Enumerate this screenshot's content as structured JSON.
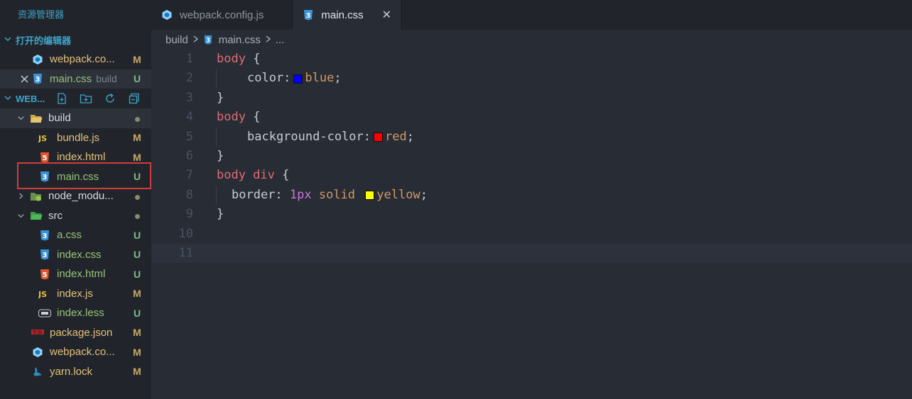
{
  "sidebar": {
    "title": "资源管理器",
    "open_editors": {
      "heading": "打开的编辑器",
      "items": [
        {
          "name": "webpack.co...",
          "desc": "",
          "status": "M"
        },
        {
          "name": "main.css",
          "desc": "build",
          "status": "U"
        }
      ]
    },
    "workspace": {
      "heading": "WEB...",
      "items": [
        {
          "name": "build",
          "status": ""
        },
        {
          "name": "bundle.js",
          "status": "M"
        },
        {
          "name": "index.html",
          "status": "M"
        },
        {
          "name": "main.css",
          "status": "U"
        },
        {
          "name": "node_modu...",
          "status": ""
        },
        {
          "name": "src",
          "status": ""
        },
        {
          "name": "a.css",
          "status": "U"
        },
        {
          "name": "index.css",
          "status": "U"
        },
        {
          "name": "index.html",
          "status": "U"
        },
        {
          "name": "index.js",
          "status": "M"
        },
        {
          "name": "index.less",
          "status": "U"
        },
        {
          "name": "package.json",
          "status": "M"
        },
        {
          "name": "webpack.co...",
          "status": "M"
        },
        {
          "name": "yarn.lock",
          "status": "M"
        }
      ]
    }
  },
  "tabs": [
    {
      "label": "webpack.config.js",
      "active": false
    },
    {
      "label": "main.css",
      "active": true,
      "close": "✕"
    }
  ],
  "breadcrumb": {
    "folder": "build",
    "file": "main.css",
    "more": "..."
  },
  "code": {
    "line_numbers": [
      "1",
      "2",
      "3",
      "4",
      "5",
      "6",
      "7",
      "8",
      "9",
      "10",
      "11"
    ],
    "l1_sel": "body",
    "l1_brace": " {",
    "l2_prop": "color:",
    "l2_val": "blue",
    "l2_end": ";",
    "l3": "}",
    "l4_sel": "body",
    "l4_brace": " {",
    "l5_prop": "background-color:",
    "l5_val": "red",
    "l5_end": ";",
    "l6": "}",
    "l7_sel": "body div",
    "l7_brace": " {",
    "l8_prop": "border: ",
    "l8_num": "1px",
    "l8_mid": " solid ",
    "l8_val": "yellow",
    "l8_end": ";",
    "l9": "}",
    "swatches": {
      "blue": "#0000ff",
      "red": "#ff0000",
      "yellow": "#ffff00"
    }
  },
  "colors": {
    "accent": "#3fa3c9",
    "modified": "#e5c07b",
    "untracked": "#98c379",
    "highlight_box": "#d23c3c"
  }
}
